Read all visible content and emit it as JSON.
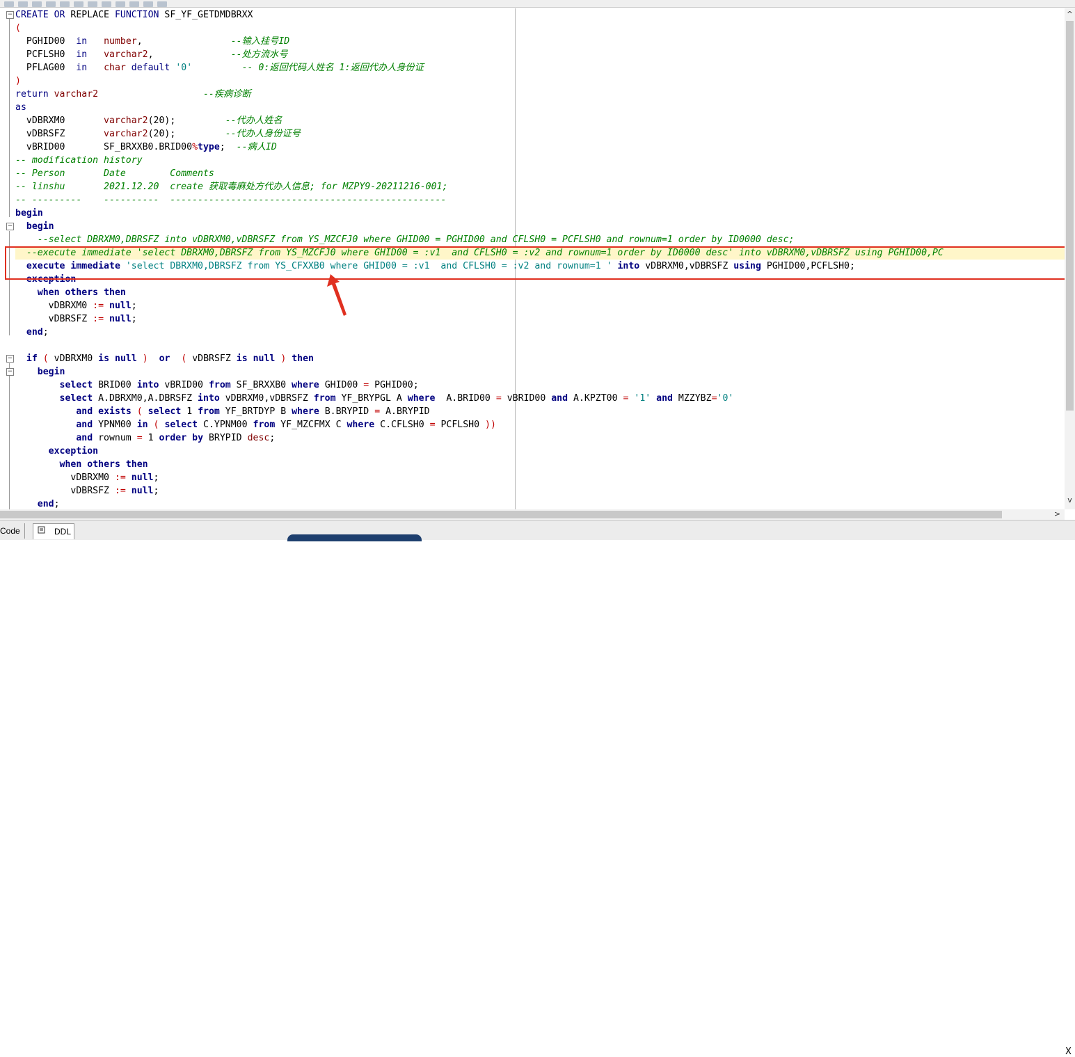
{
  "tabs": {
    "code_label": "Code",
    "ddl_label": "DDL",
    "ddl_icon_text": "SQL"
  },
  "scroll": {
    "up": "^",
    "down": "v",
    "right": ">",
    "close": "X"
  },
  "colors": {
    "keyword": "#000080",
    "comment": "#008000",
    "string": "#008080",
    "highlight_box": "#e03020"
  }
}
